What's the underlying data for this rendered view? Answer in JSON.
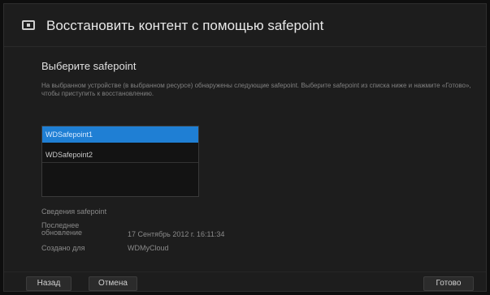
{
  "dialog": {
    "title": "Восстановить контент с помощью safepoint",
    "heading": "Выберите safepoint",
    "instructions": "На выбранном устройстве (в выбранном ресурсе) обнаружены следующие safepoint. Выберите safepoint из списка ниже и нажмите «Готово», чтобы приступить к восстановлению."
  },
  "safepoints": [
    {
      "label": "WDSafepoint1",
      "selected": true
    },
    {
      "label": "WDSafepoint2",
      "selected": false
    }
  ],
  "details": {
    "heading": "Сведения safepoint",
    "last_updated_label": "Последнее обновление",
    "last_updated_value": "17 Сентябрь 2012 г. 16:11:34",
    "created_by_label": "Создано для",
    "created_by_value": "WDMyCloud"
  },
  "buttons": {
    "back": "Назад",
    "cancel": "Отмена",
    "done": "Готово"
  },
  "colors": {
    "accent": "#1f7fd4",
    "background": "#1d1d1d"
  }
}
